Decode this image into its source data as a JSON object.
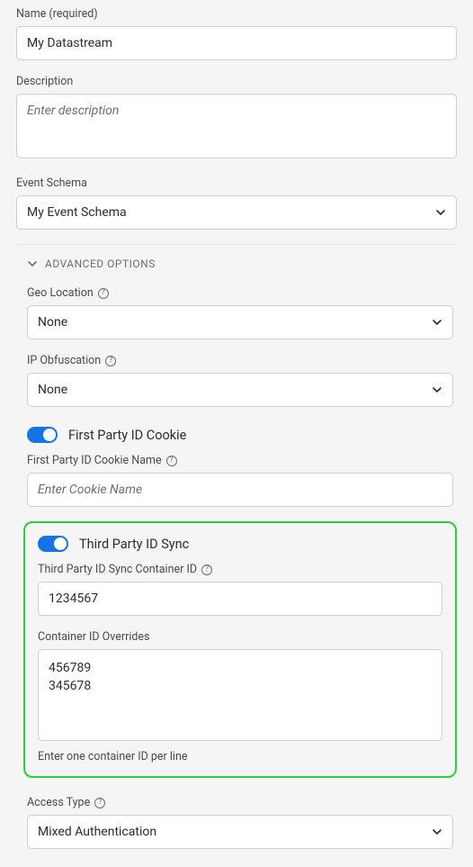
{
  "name": {
    "label": "Name (required)",
    "value": "My Datastream"
  },
  "description": {
    "label": "Description",
    "placeholder": "Enter description",
    "value": ""
  },
  "eventSchema": {
    "label": "Event Schema",
    "value": "My Event Schema"
  },
  "advancedHeader": "ADVANCED OPTIONS",
  "geoLocation": {
    "label": "Geo Location",
    "value": "None"
  },
  "ipObfuscation": {
    "label": "IP Obfuscation",
    "value": "None"
  },
  "firstPartyCookie": {
    "toggleLabel": "First Party ID Cookie",
    "nameLabel": "First Party ID Cookie Name",
    "placeholder": "Enter Cookie Name",
    "value": ""
  },
  "thirdPartySync": {
    "toggleLabel": "Third Party ID Sync",
    "containerLabel": "Third Party ID Sync Container ID",
    "containerValue": "1234567",
    "overridesLabel": "Container ID Overrides",
    "overridesValue": "456789\n345678",
    "helper": "Enter one container ID per line"
  },
  "accessType": {
    "label": "Access Type",
    "value": "Mixed Authentication"
  }
}
